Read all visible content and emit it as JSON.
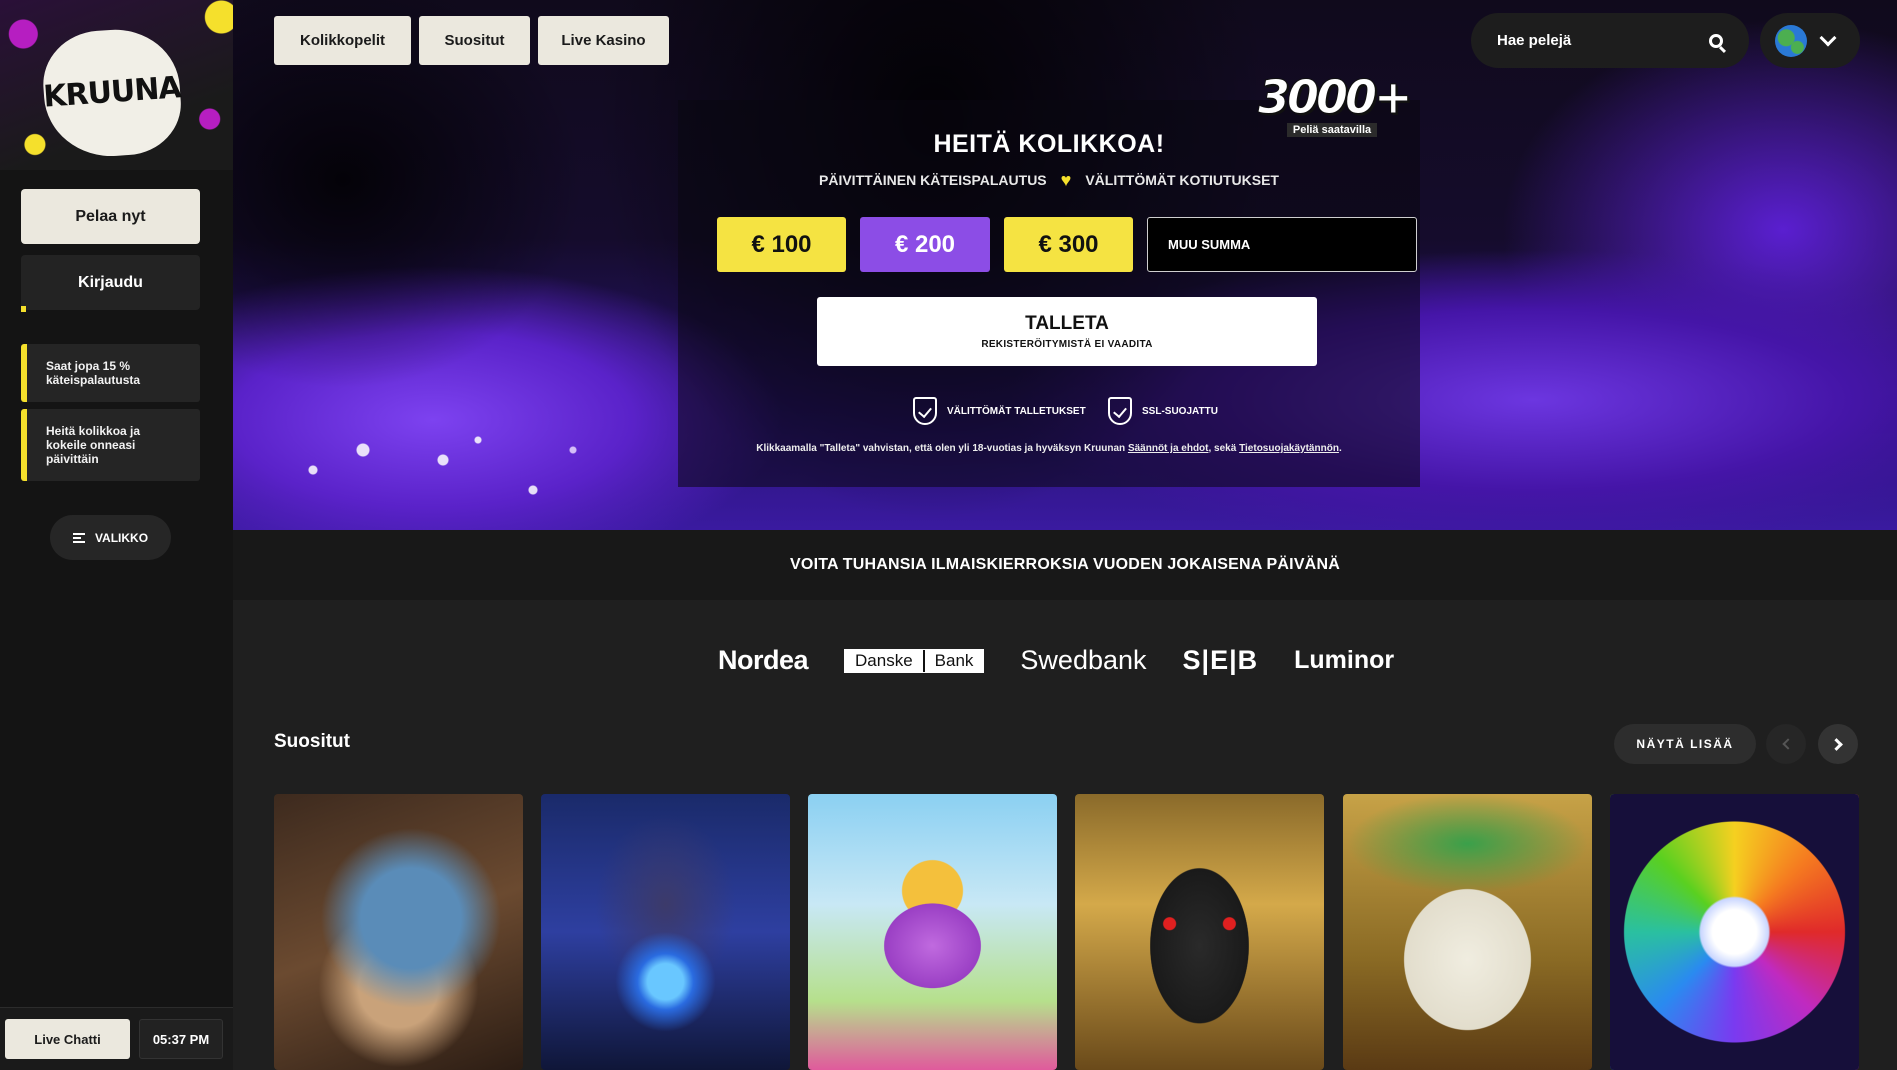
{
  "sidebar": {
    "logo_text": "KRUUNA",
    "play_label": "Pelaa nyt",
    "login_label": "Kirjaudu",
    "promos": [
      "Saat jopa 15 % käteispalautusta",
      "Heitä kolikkoa ja kokeile onneasi päivittäin"
    ],
    "menu_label": "VALIKKO",
    "chat_label": "Live Chatti",
    "time": "05:37 PM"
  },
  "header": {
    "tabs": [
      "Kolikkopelit",
      "Suositut",
      "Live Kasino"
    ],
    "search_placeholder": "Hae pelejä",
    "language_icon": "globe-icon"
  },
  "hero": {
    "badge_number": "3000+",
    "badge_sub": "Peliä saatavilla",
    "title": "HEITÄ KOLIKKOA!",
    "sub_left": "PÄIVITTÄINEN KÄTEISPALAUTUS",
    "sub_right": "VÄLITTÖMÄT KOTIUTUKSET",
    "amounts": [
      "€ 100",
      "€ 200",
      "€ 300"
    ],
    "selected_amount": "€ 200",
    "other_amount_placeholder": "MUU SUMMA",
    "deposit_label": "TALLETA",
    "deposit_sub": "REKISTERÖITYMISTÄ EI VAADITA",
    "trust": [
      "VÄLITTÖMÄT TALLETUKSET",
      "SSL-SUOJATTU"
    ],
    "terms_prefix": "Klikkaamalla \"Talleta\" vahvistan, että olen yli 18-vuotias ja hyväksyn Kruunan",
    "terms_link": "Säännöt ja ehdot",
    "terms_mid": ", sekä",
    "privacy_link": "Tietosuojakäytännön",
    "terms_suffix": "."
  },
  "strip_text": "VOITA TUHANSIA ILMAISKIERROKSIA VUODEN JOKAISENA PÄIVÄNÄ",
  "banks": {
    "nordea": "Nordea",
    "danske_1": "Danske",
    "danske_2": "Bank",
    "swedbank": "Swedbank",
    "seb": "S|E|B",
    "luminor": "Luminor"
  },
  "popular": {
    "title": "Suositut",
    "show_more": "NÄYTÄ LISÄÄ"
  },
  "colors": {
    "accent_yellow": "#f5e342",
    "accent_purple": "#8c4de6",
    "cream": "#ebe8de",
    "background": "#1f1f1f"
  }
}
